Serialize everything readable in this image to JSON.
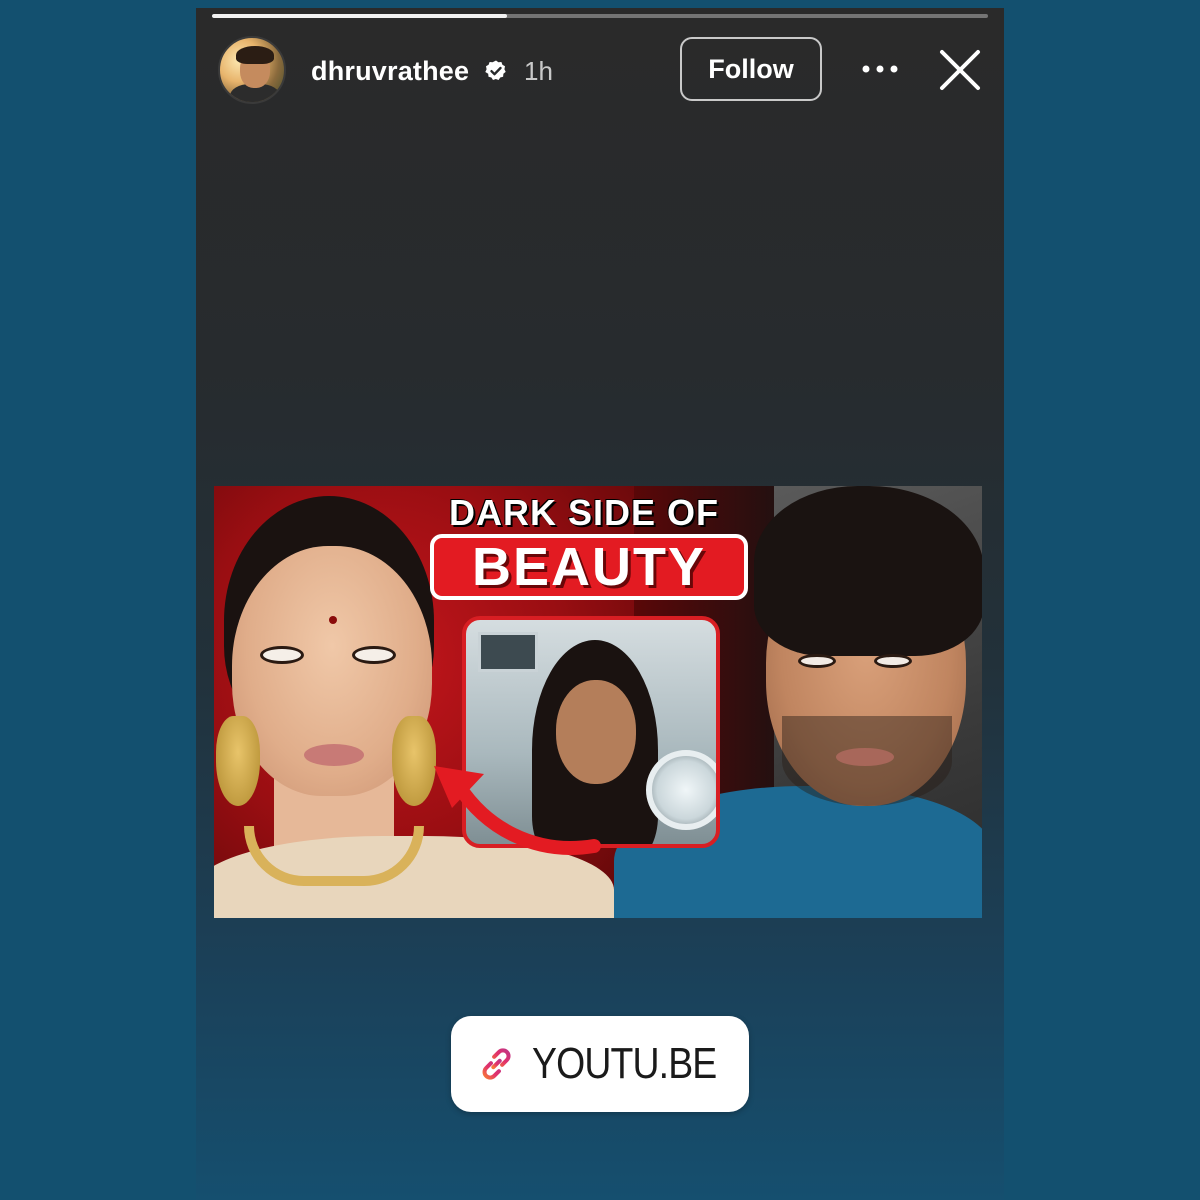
{
  "story": {
    "progress": 0.38,
    "user": {
      "username": "dhruvrathee",
      "verified": true,
      "time_ago": "1h"
    },
    "follow_label": "Follow",
    "icons": {
      "verified": "verified-badge-icon",
      "more": "more-options-icon",
      "close": "close-icon",
      "link": "link-icon"
    }
  },
  "thumbnail": {
    "title_top": "DARK SIDE OF",
    "title_main": "BEAUTY"
  },
  "link_sticker": {
    "label": "YOUTU.BE"
  },
  "colors": {
    "page_background": "#13506f",
    "thumbnail_red": "#e31b22",
    "link_gradient_start": "#f56040",
    "link_gradient_end": "#c13584"
  }
}
